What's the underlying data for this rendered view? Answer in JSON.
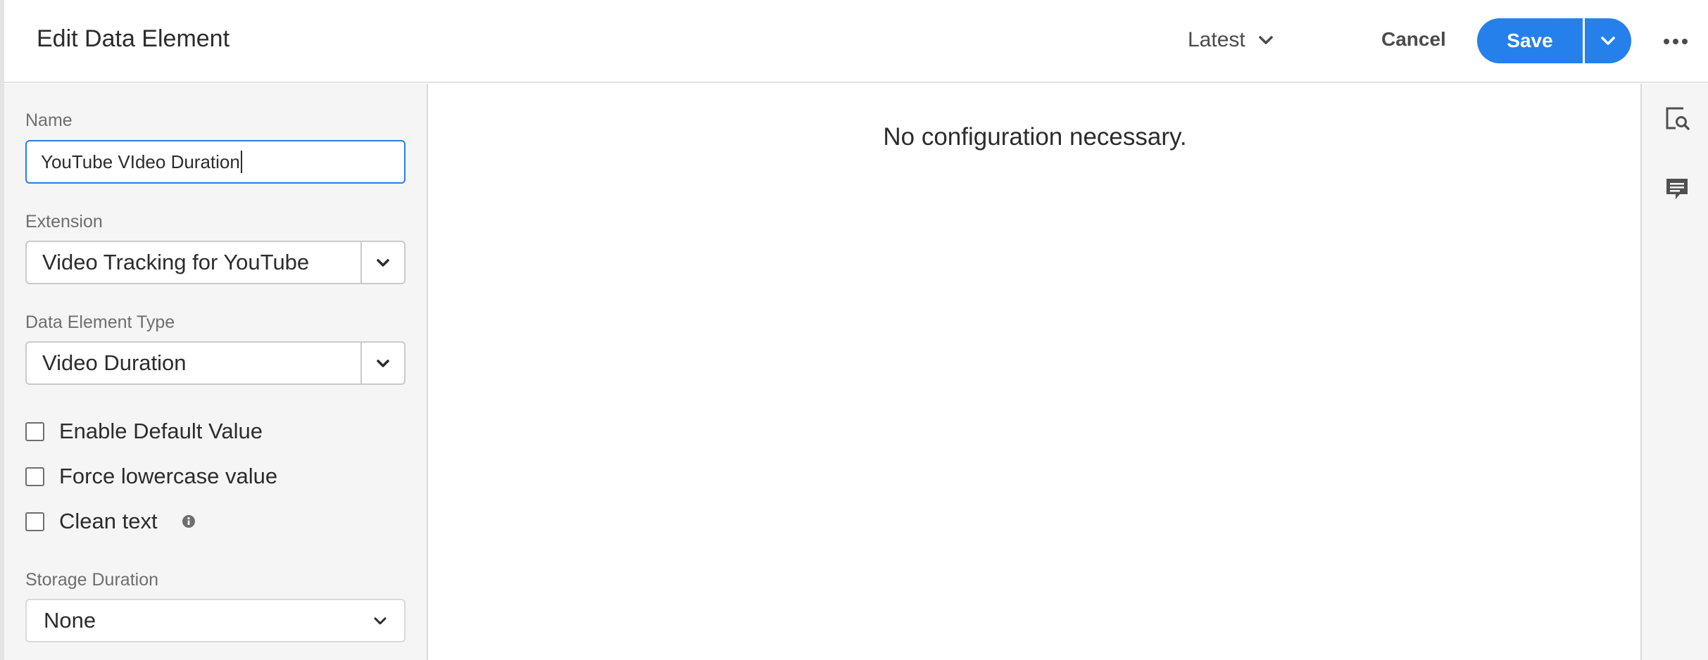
{
  "header": {
    "title": "Edit Data Element",
    "version": "Latest",
    "cancel_label": "Cancel",
    "save_label": "Save"
  },
  "form": {
    "name": {
      "label": "Name",
      "value": "YouTube VIdeo Duration"
    },
    "extension": {
      "label": "Extension",
      "value": "Video Tracking for YouTube"
    },
    "type": {
      "label": "Data Element Type",
      "value": "Video Duration"
    },
    "checkboxes": [
      {
        "label": "Enable Default Value",
        "checked": false
      },
      {
        "label": "Force lowercase value",
        "checked": false
      },
      {
        "label": "Clean text",
        "checked": false
      }
    ],
    "storage": {
      "label": "Storage Duration",
      "value": "None"
    }
  },
  "main": {
    "message": "No configuration necessary."
  },
  "icons": {
    "version_caret": "chevron-down-icon",
    "save_menu": "chevron-down-icon",
    "more": "more-dots-icon",
    "info": "info-icon",
    "rail_preview": "preview-search-icon",
    "rail_comments": "comment-icon"
  },
  "colors": {
    "accent": "#2680eb",
    "panel_bg": "#f5f5f5"
  }
}
